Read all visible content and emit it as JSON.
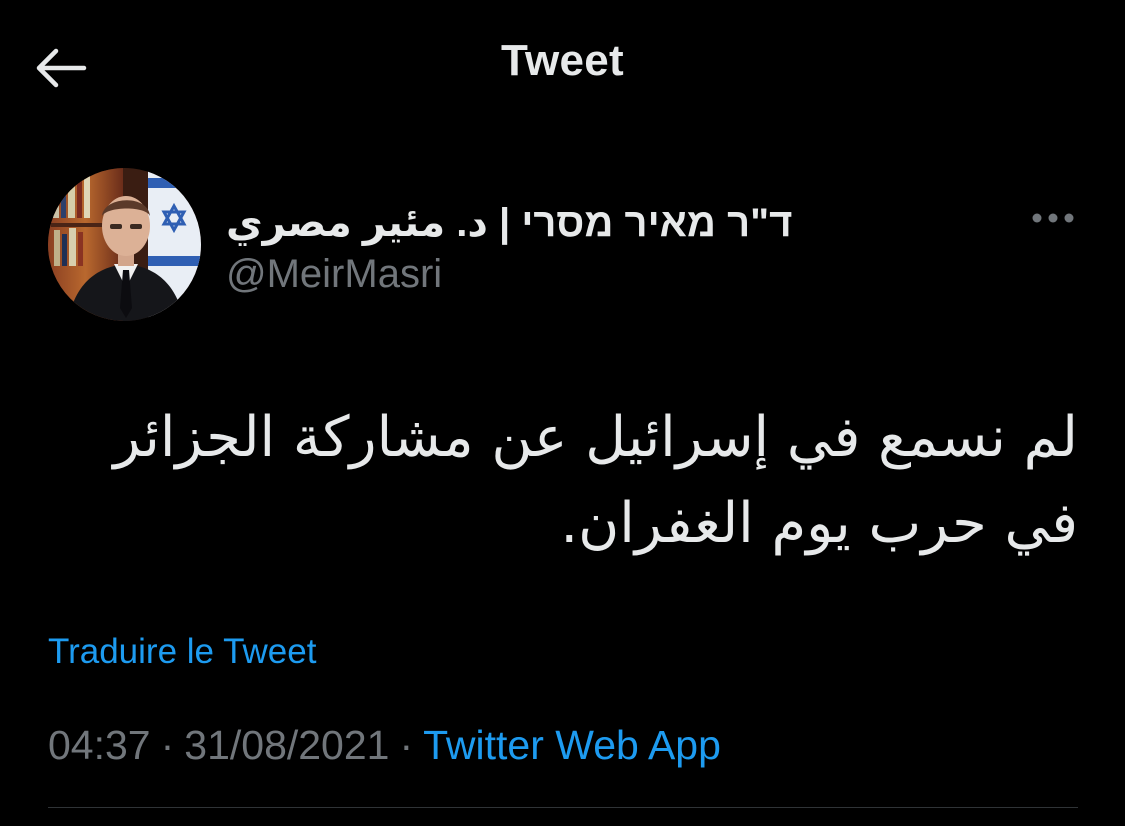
{
  "header": {
    "title": "Tweet",
    "back_icon": "arrow-left-icon"
  },
  "author": {
    "display_name": "ד\"ר מאיר מסרי | د. مئير مصري",
    "handle": "@MeirMasri",
    "avatar": "profile-photo",
    "more_icon": "more-horizontal-icon"
  },
  "tweet": {
    "text": "لم نسمع في إسرائيل عن مشاركة الجزائر في حرب يوم الغفران.",
    "translate_label": "Traduire le Tweet",
    "time": "04:37",
    "date": "31/08/2021",
    "source": "Twitter Web App",
    "separator": "·"
  },
  "colors": {
    "background": "#000000",
    "text_primary": "#e7e9ea",
    "text_secondary": "#71767b",
    "accent": "#1d9bf0",
    "divider": "#2f3336"
  }
}
